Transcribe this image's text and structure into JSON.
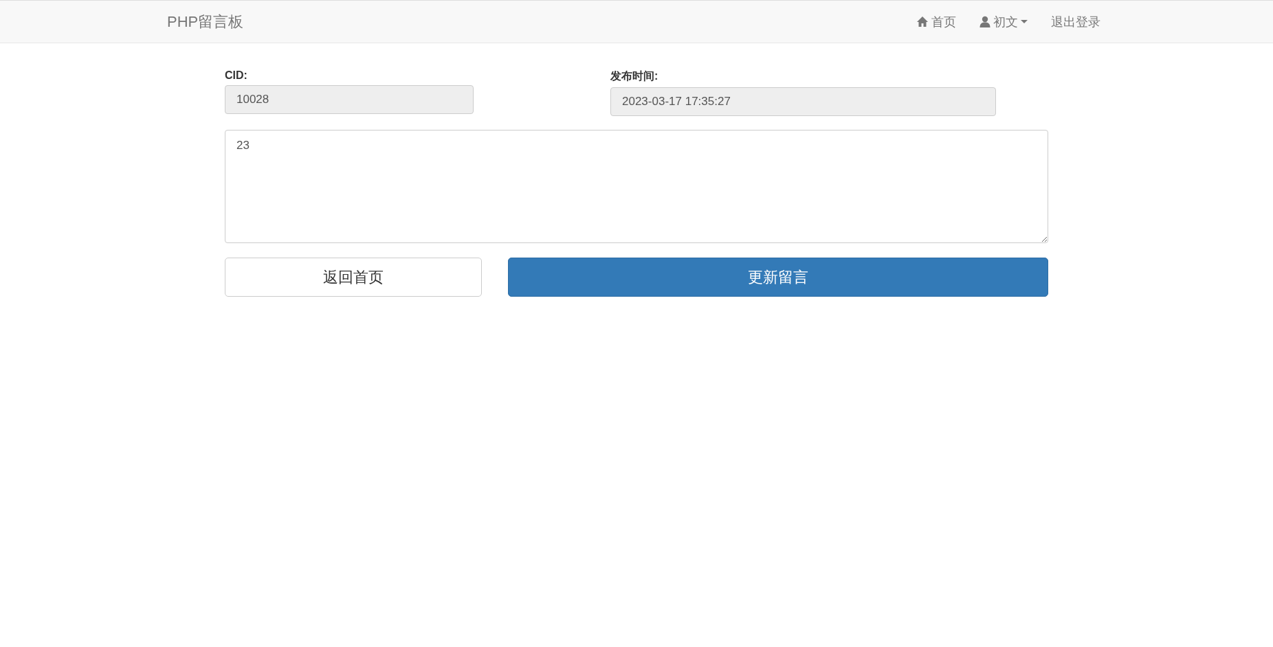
{
  "navbar": {
    "brand": "PHP留言板",
    "items": [
      {
        "kind": "home",
        "label": "首页"
      },
      {
        "kind": "user",
        "label": "初文",
        "dropdown": true
      },
      {
        "kind": "plain",
        "label": "退出登录"
      }
    ]
  },
  "form": {
    "fields": [
      {
        "label": "CID:",
        "value": "10028",
        "disabled": true
      },
      {
        "label": "发布时间:",
        "value": "2023-03-17 17:35:27",
        "disabled": true
      }
    ],
    "content": {
      "value": "23"
    },
    "buttons": [
      {
        "label": "返回首页",
        "kind": "default"
      },
      {
        "label": "更新留言",
        "kind": "primary"
      }
    ]
  }
}
